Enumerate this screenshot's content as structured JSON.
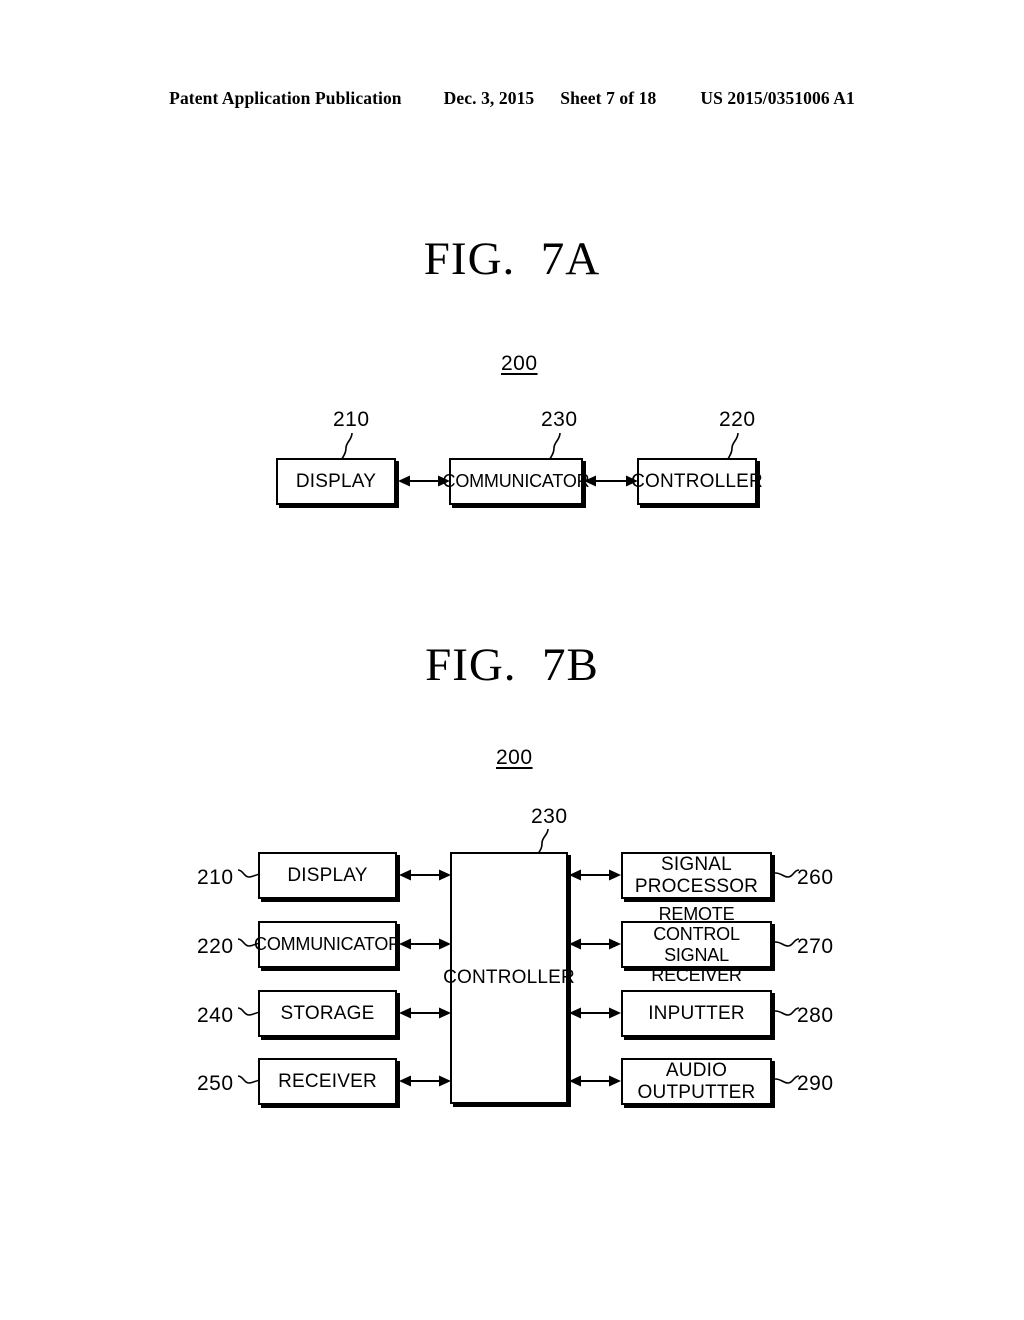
{
  "header": {
    "publication": "Patent Application Publication",
    "date": "Dec. 3, 2015",
    "sheet": "Sheet 7 of 18",
    "patent_number": "US 2015/0351006 A1"
  },
  "figures": [
    {
      "id": "fig7a",
      "title": "FIG.  7A",
      "system_ref": "200",
      "blocks": [
        {
          "ref": "210",
          "label": "DISPLAY"
        },
        {
          "ref": "230",
          "label": "COMMUNICATOR"
        },
        {
          "ref": "220",
          "label": "CONTROLLER"
        }
      ],
      "connections": [
        {
          "from": "DISPLAY",
          "to": "COMMUNICATOR",
          "type": "bidirectional"
        },
        {
          "from": "COMMUNICATOR",
          "to": "CONTROLLER",
          "type": "bidirectional"
        }
      ]
    },
    {
      "id": "fig7b",
      "title": "FIG.  7B",
      "system_ref": "200",
      "center_block": {
        "ref": "230",
        "label": "CONTROLLER"
      },
      "left_blocks": [
        {
          "ref": "210",
          "label": "DISPLAY"
        },
        {
          "ref": "220",
          "label": "COMMUNICATOR"
        },
        {
          "ref": "240",
          "label": "STORAGE"
        },
        {
          "ref": "250",
          "label": "RECEIVER"
        }
      ],
      "right_blocks": [
        {
          "ref": "260",
          "label": "SIGNAL\nPROCESSOR"
        },
        {
          "ref": "270",
          "label": "REMOTE CONTROL\nSIGNAL RECEIVER"
        },
        {
          "ref": "280",
          "label": "INPUTTER"
        },
        {
          "ref": "290",
          "label": "AUDIO\nOUTPUTTER"
        }
      ],
      "connections": [
        {
          "from": "DISPLAY",
          "to": "CONTROLLER",
          "type": "bidirectional"
        },
        {
          "from": "COMMUNICATOR",
          "to": "CONTROLLER",
          "type": "bidirectional"
        },
        {
          "from": "STORAGE",
          "to": "CONTROLLER",
          "type": "bidirectional"
        },
        {
          "from": "RECEIVER",
          "to": "CONTROLLER",
          "type": "bidirectional"
        },
        {
          "from": "CONTROLLER",
          "to": "SIGNAL PROCESSOR",
          "type": "bidirectional"
        },
        {
          "from": "CONTROLLER",
          "to": "REMOTE CONTROL SIGNAL RECEIVER",
          "type": "bidirectional"
        },
        {
          "from": "CONTROLLER",
          "to": "INPUTTER",
          "type": "bidirectional"
        },
        {
          "from": "CONTROLLER",
          "to": "AUDIO OUTPUTTER",
          "type": "bidirectional"
        }
      ]
    }
  ],
  "colors": {
    "ink": "#000000",
    "paper": "#ffffff"
  }
}
